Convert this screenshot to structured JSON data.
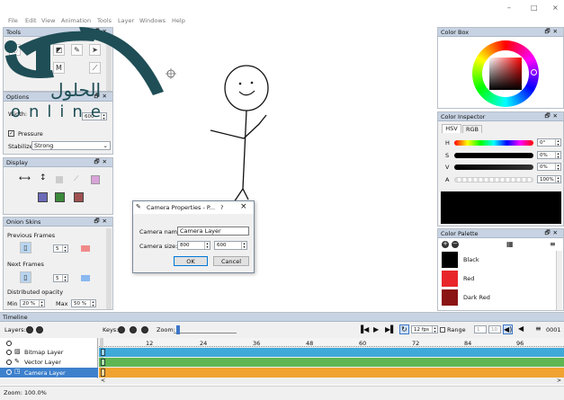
{
  "menu": [
    "File",
    "Edit",
    "View",
    "Animation",
    "Tools",
    "Layer",
    "Windows",
    "Help"
  ],
  "window_controls": [
    "–",
    "□",
    "×"
  ],
  "tools_panel": {
    "title": "Tools",
    "options_title": "Options",
    "width_label": "Width:",
    "width_value": "600",
    "pressure_label": "Pressure",
    "stabilizer_label": "Stabilizer",
    "stabilizer_value": "Strong"
  },
  "display_panel": {
    "title": "Display"
  },
  "onion_panel": {
    "title": "Onion Skins",
    "previous_frames": "Previous Frames",
    "previous_value": "5",
    "next_frames": "Next Frames",
    "next_value": "5",
    "distributed_opacity": "Distributed opacity",
    "min_label": "Min",
    "min_value": "20 %",
    "max_label": "Max",
    "max_value": "50 %"
  },
  "color_box": {
    "title": "Color Box"
  },
  "color_inspector": {
    "title": "Color Inspector",
    "tabs": [
      "HSV",
      "RGB"
    ],
    "rows": [
      {
        "label": "H",
        "value": "0°"
      },
      {
        "label": "S",
        "value": "0%"
      },
      {
        "label": "V",
        "value": "0%"
      },
      {
        "label": "A",
        "value": "100%"
      }
    ]
  },
  "color_palette": {
    "title": "Color Palette",
    "items": [
      {
        "name": "Black",
        "color": "#000000"
      },
      {
        "name": "Red",
        "color": "#e8262a"
      },
      {
        "name": "Dark Red",
        "color": "#8b1414"
      }
    ]
  },
  "dialog": {
    "title": "Camera Properties - P...",
    "help": "?",
    "close": "×",
    "camera_name_label": "Camera name:",
    "camera_name_value": "Camera Layer",
    "camera_size_label": "Camera size:",
    "width": "800",
    "height": "600",
    "ok": "OK",
    "cancel": "Cancel"
  },
  "timeline": {
    "title": "Timeline",
    "layers_label": "Layers:",
    "keys_label": "Keys:",
    "zoom_label": "Zoom:",
    "fps_value": "12 fps",
    "range_label": "Range",
    "range_start": "1",
    "range_end": "10",
    "frame_counter": "0001",
    "ruler": [
      "12",
      "24",
      "36",
      "48",
      "60",
      "72",
      "84",
      "96"
    ],
    "layers": [
      {
        "name": "Bitmap Layer",
        "color": "#3fa9d8"
      },
      {
        "name": "Vector Layer",
        "color": "#5fb653"
      },
      {
        "name": "Camera Layer",
        "color": "#f0a330"
      }
    ]
  },
  "status": {
    "zoom": "Zoom: 100.0%"
  },
  "watermark": {
    "arabic": "الحلول",
    "latin": "online"
  }
}
